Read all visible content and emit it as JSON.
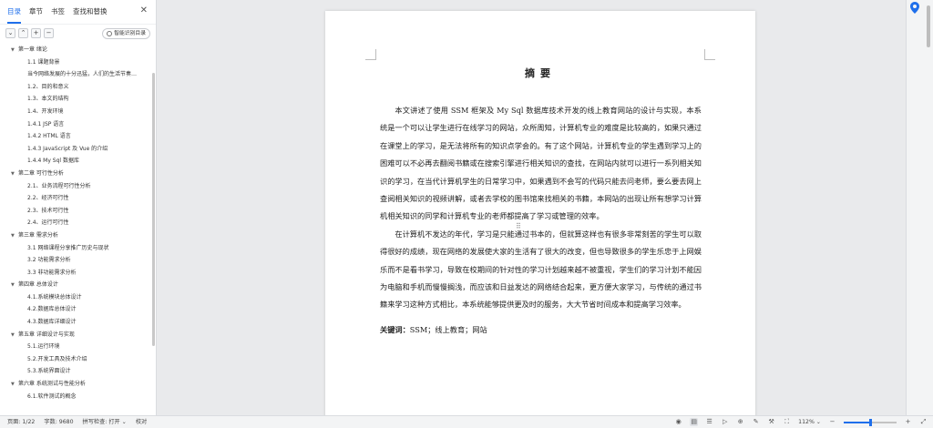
{
  "nav": {
    "tabs": [
      "目录",
      "章节",
      "书签",
      "查找和替换"
    ],
    "active_tab": 0,
    "close_icon": "close-icon",
    "tools": {
      "collapse": "⌄",
      "up": "⌃",
      "add": "+",
      "remove": "−"
    },
    "smart_btn": "智能识别目录",
    "toc": [
      {
        "level": 1,
        "text": "第一章 绪论"
      },
      {
        "level": 2,
        "text": "1.1 课题背景"
      },
      {
        "level": 2,
        "text": "当今网络发展的十分迅猛，人们的生活节奏…"
      },
      {
        "level": 2,
        "text": "1.2、目的和意义"
      },
      {
        "level": 2,
        "text": "1.3、本文的结构"
      },
      {
        "level": 2,
        "text": "1.4、开发环境"
      },
      {
        "level": 2,
        "text": "1.4.1 JSP 语言"
      },
      {
        "level": 2,
        "text": "1.4.2 HTML 语言"
      },
      {
        "level": 2,
        "text": "1.4.3 JavaScript 及 Vue 的介绍"
      },
      {
        "level": 2,
        "text": "1.4.4 My Sql 数据库"
      },
      {
        "level": 1,
        "text": "第二章 可行性分析"
      },
      {
        "level": 2,
        "text": "2.1、业务流程可行性分析"
      },
      {
        "level": 2,
        "text": "2.2、经济可行性"
      },
      {
        "level": 2,
        "text": "2.3、技术可行性"
      },
      {
        "level": 2,
        "text": "2.4、运行可行性"
      },
      {
        "level": 1,
        "text": "第三章 需求分析"
      },
      {
        "level": 2,
        "text": "3.1 网络课程分享推广历史与现状"
      },
      {
        "level": 2,
        "text": "3.2 功能需求分析"
      },
      {
        "level": 2,
        "text": "3.3 非功能需求分析"
      },
      {
        "level": 1,
        "text": "第四章 总体设计"
      },
      {
        "level": 2,
        "text": "4.1.系统模块总体设计"
      },
      {
        "level": 2,
        "text": "4.2.数据库总体设计"
      },
      {
        "level": 2,
        "text": "4.3.数据库详细设计"
      },
      {
        "level": 1,
        "text": "第五章 详细设计与实现"
      },
      {
        "level": 2,
        "text": "5.1.运行环境"
      },
      {
        "level": 2,
        "text": "5.2.开发工具及技术介绍"
      },
      {
        "level": 2,
        "text": "5.3.系统界面设计"
      },
      {
        "level": 1,
        "text": "第六章 系统测试与性能分析"
      },
      {
        "level": 2,
        "text": "6.1.软件测试的概念"
      }
    ]
  },
  "document": {
    "title": "摘要",
    "paragraphs": [
      "本文讲述了使用 SSM 框架及 My Sql 数据库技术开发的线上教育网站的设计与实现，本系统是一个可以让学生进行在线学习的网站，众所周知，计算机专业的难度是比较高的，如果只通过在课堂上的学习，是无法将所有的知识点学会的。有了这个网站，计算机专业的学生遇到学习上的困难可以不必再去翻阅书籍或在搜索引擎进行相关知识的查找，在网站内就可以进行一系列相关知识的学习，在当代计算机学生的日常学习中，如果遇到不会写的代码只能去问老师，要么要去网上查阅相关知识的视频讲解，或者去学校的图书馆来找相关的书籍，本网站的出现让所有想学习计算机相关知识的同学和计算机专业的老师都提高了学习或管理的效率。",
      "在计算机不发达的年代，学习是只能通过书本的，但就算这样也有很多非常刻苦的学生可以取得很好的成绩，现在网络的发展使大家的生活有了很大的改变，但也导致很多的学生乐忠于上网娱乐而不是看书学习，导致在校期间的针对性的学习计划越来越不被重视，学生们的学习计划不能因为电脑和手机而慢慢搁浅，而应该和日益发达的网络结合起来，更方便大家学习，与传统的通过书籍来学习这种方式相比，本系统能够提供更及时的服务，大大节省时间成本和提高学习效率。"
    ],
    "keywords_label": "关键词：",
    "keywords": "SSM；线上教育；网站"
  },
  "status": {
    "page": "页面: 1/22",
    "words": "字数: 9680",
    "spell": "拼写检查: 打开 ⌄",
    "proof": "校对",
    "zoom": "112% ⌄",
    "zoom_level": 0.5
  },
  "right": {
    "location_icon": "location-pin-icon"
  }
}
